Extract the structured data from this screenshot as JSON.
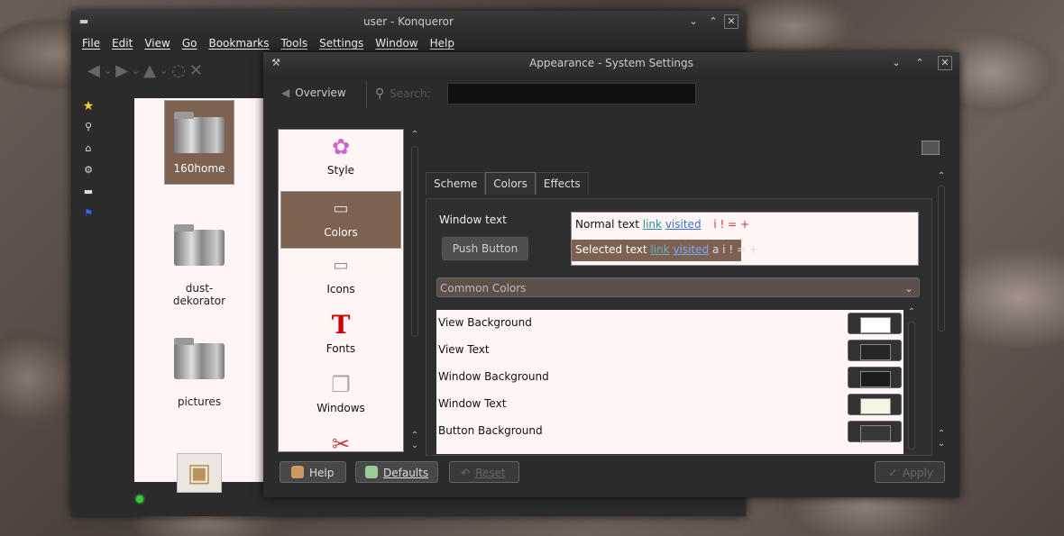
{
  "konqueror": {
    "title": "user - Konqueror",
    "menu": [
      "File",
      "Edit",
      "View",
      "Go",
      "Bookmarks",
      "Tools",
      "Settings",
      "Window",
      "Help"
    ],
    "files": [
      "160home",
      "dust-dekorator",
      "pictures"
    ]
  },
  "settings": {
    "title": "Appearance - System Settings",
    "overview_label": "Overview",
    "search_label": "Search:",
    "search_value": "",
    "categories": [
      "Style",
      "Colors",
      "Icons",
      "Fonts",
      "Windows"
    ],
    "tabs": [
      "Scheme",
      "Colors",
      "Effects"
    ],
    "window_text_label": "Window text",
    "push_button_label": "Push Button",
    "preview": {
      "normal": {
        "word1": "Normal",
        "word2": "text",
        "link": "link",
        "visited": "visited",
        "marks": "i ! = +"
      },
      "selected": {
        "word1": "Selected",
        "word2": "text",
        "link": "link",
        "visited": "visited",
        "marks": "a i ! = +"
      }
    },
    "color_set": "Common Colors",
    "color_rows": [
      {
        "label": "View Background",
        "color": "#ffffff"
      },
      {
        "label": "View Text",
        "color": "#262626"
      },
      {
        "label": "Window Background",
        "color": "#1c1c1c"
      },
      {
        "label": "Window Text",
        "color": "#f5f5e6"
      },
      {
        "label": "Button Background",
        "color": "#383838"
      }
    ],
    "buttons": {
      "help": "Help",
      "defaults": "Defaults",
      "reset": "Reset",
      "apply": "Apply"
    }
  }
}
